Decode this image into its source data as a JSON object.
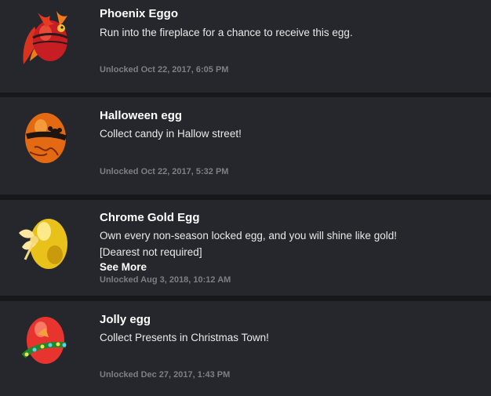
{
  "achievements": [
    {
      "title": "Phoenix Eggo",
      "description": "Run into the fireplace for a chance to receive this egg.",
      "unlocked": "Unlocked Oct 22, 2017, 6:05 PM",
      "icon": "phoenix-egg-icon"
    },
    {
      "title": "Halloween egg",
      "description": "Collect candy in Hallow street!",
      "unlocked": "Unlocked Oct 22, 2017, 5:32 PM",
      "icon": "halloween-egg-icon"
    },
    {
      "title": "Chrome Gold Egg",
      "description": "Own every non-season locked egg, and you will shine like gold!",
      "description_extra": "[Dearest not required]",
      "see_more": "See More",
      "unlocked": "Unlocked Aug 3, 2018, 10:12 AM",
      "icon": "chrome-gold-egg-icon"
    },
    {
      "title": "Jolly egg",
      "description": "Collect Presents in Christmas Town!",
      "unlocked": "Unlocked Dec 27, 2017, 1:43 PM",
      "icon": "jolly-egg-icon"
    }
  ],
  "colors": {
    "background": "#17181c",
    "card": "#25272d",
    "title": "#ffffff",
    "description": "#e9e9ea",
    "date": "#7e7f84"
  }
}
